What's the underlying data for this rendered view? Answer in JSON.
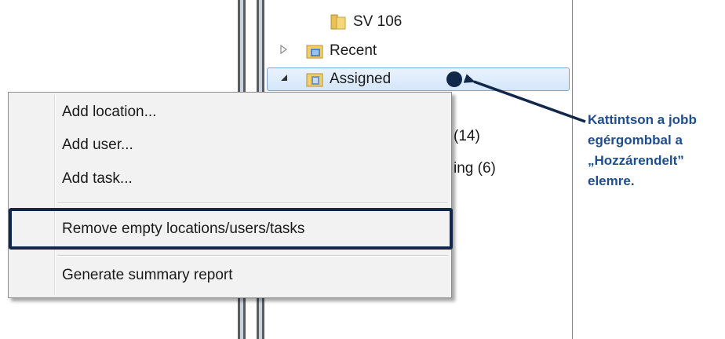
{
  "tree": {
    "sv106_label": "SV 106",
    "recent_label": "Recent",
    "assigned_label": "Assigned",
    "partial_row_1": "(14)",
    "partial_row_2": "ing (6)"
  },
  "context_menu": {
    "add_location": "Add location...",
    "add_user": "Add user...",
    "add_task": "Add task...",
    "remove_empty": "Remove empty locations/users/tasks",
    "generate_report": "Generate summary report"
  },
  "annotation": {
    "line1": "Kattintson a jobb",
    "line2": "egérgombbal a",
    "line3": "„Hozzárendelt”",
    "line4": "elemre.",
    "color": "#1f4e8c"
  },
  "icons": {
    "folder": "folder-icon",
    "recent": "recent-folder-icon",
    "assigned": "assigned-folder-icon",
    "expand": "expand-triangle-icon",
    "collapse": "collapse-triangle-icon"
  }
}
